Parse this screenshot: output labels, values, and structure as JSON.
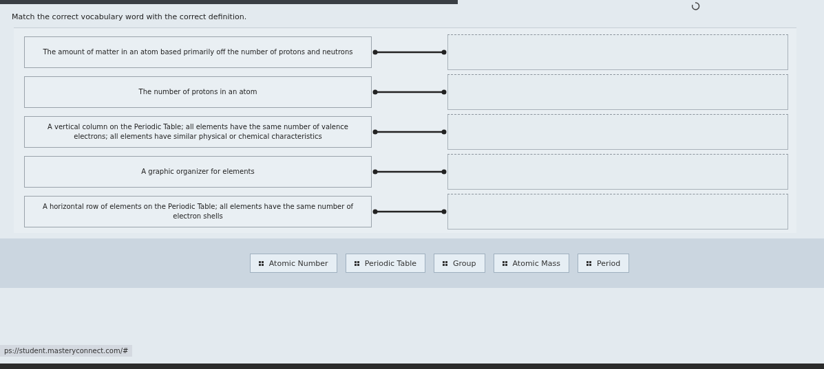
{
  "instruction": "Match the correct vocabulary word with the correct definition.",
  "definitions": [
    {
      "text": "The amount of matter in an atom based primarily off the number of protons and neutrons"
    },
    {
      "text": "The number of protons in an atom"
    },
    {
      "text": "A vertical column on the Periodic Table; all elements have the same number of valence electrons; all elements have similar physical or chemical characteristics"
    },
    {
      "text": "A graphic organizer for elements"
    },
    {
      "text": "A horizontal row of elements on the Periodic Table; all elements have the same number of electron shells"
    }
  ],
  "word_bank": [
    "Atomic Number",
    "Periodic Table",
    "Group",
    "Atomic Mass",
    "Period"
  ],
  "status_bar": {
    "url": "ps://student.masteryconnect.com/#"
  }
}
